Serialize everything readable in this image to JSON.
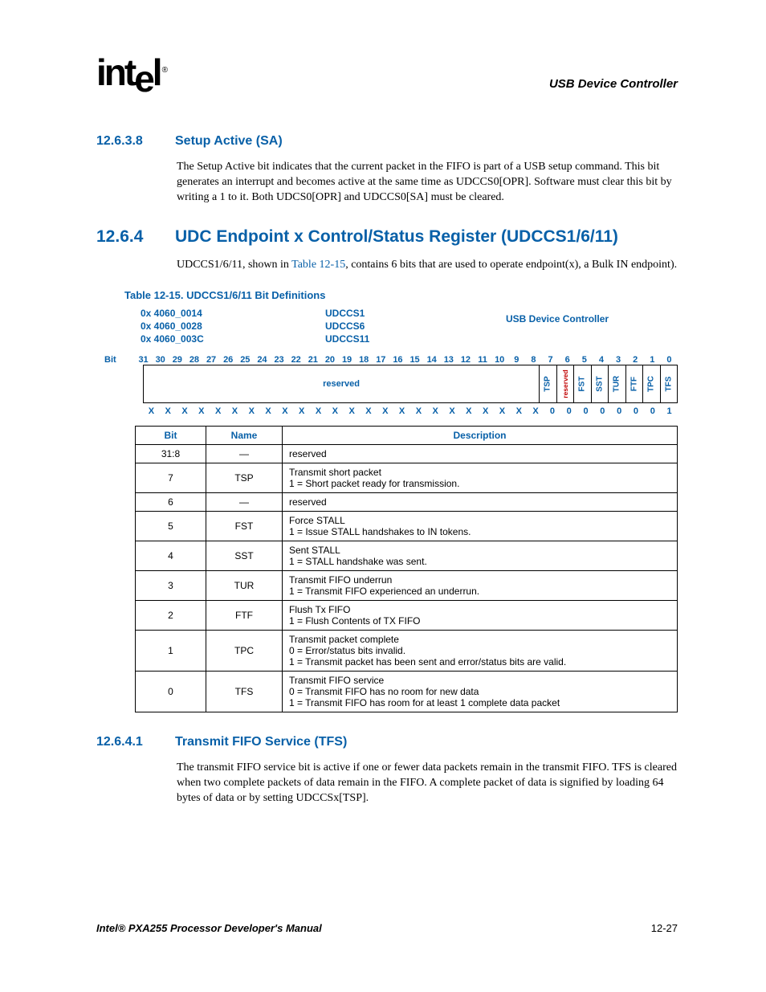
{
  "header": {
    "logo_text": "intel",
    "chapter": "USB Device Controller"
  },
  "sec1": {
    "num": "12.6.3.8",
    "title": "Setup Active (SA)",
    "para": "The Setup Active bit indicates that the current packet in the FIFO is part of a USB setup command. This bit generates an interrupt and becomes active at the same time as UDCCS0[OPR]. Software must clear this bit by writing a 1 to it. Both UDCS0[OPR] and UDCCS0[SA] must be cleared."
  },
  "sec2": {
    "num": "12.6.4",
    "title": "UDc Endpoint x Control/Status Register (UDCCS1/6/11)",
    "title_actual": "UDC Endpoint x Control/Status Register (UDCCS1/6/11)",
    "para_pre": "UDCCS1/6/11, shown in ",
    "para_link": "Table 12-15",
    "para_post": ", contains 6 bits that are used to operate endpoint(x), a Bulk IN endpoint)."
  },
  "table_caption": "Table 12-15. UDCCS1/6/11 Bit Definitions",
  "reg_header": {
    "addrs": [
      "0x 4060_0014",
      "0x 4060_0028",
      "0x 4060_003C"
    ],
    "names": [
      "UDCCS1",
      "UDCCS6",
      "UDCCS11"
    ],
    "module": "USB Device Controller"
  },
  "bits_label": "Bit",
  "bit_numbers": [
    "31",
    "30",
    "29",
    "28",
    "27",
    "26",
    "25",
    "24",
    "23",
    "22",
    "21",
    "20",
    "19",
    "18",
    "17",
    "16",
    "15",
    "14",
    "13",
    "12",
    "11",
    "10",
    "9",
    "8",
    "7",
    "6",
    "5",
    "4",
    "3",
    "2",
    "1",
    "0"
  ],
  "fields": {
    "reserved": "reserved",
    "list": [
      "TSP",
      "reserved",
      "FST",
      "SST",
      "TUR",
      "FTF",
      "TPC",
      "TFS"
    ]
  },
  "reset_values": [
    "X",
    "X",
    "X",
    "X",
    "X",
    "X",
    "X",
    "X",
    "X",
    "X",
    "X",
    "X",
    "X",
    "X",
    "X",
    "X",
    "X",
    "X",
    "X",
    "X",
    "X",
    "X",
    "X",
    "X",
    "0",
    "0",
    "0",
    "0",
    "0",
    "0",
    "0",
    "1"
  ],
  "def_table": {
    "headers": [
      "Bit",
      "Name",
      "Description"
    ],
    "rows": [
      {
        "bit": "31:8",
        "name": "—",
        "desc": "reserved"
      },
      {
        "bit": "7",
        "name": "TSP",
        "desc": "Transmit short packet\n1 =   Short packet ready for transmission."
      },
      {
        "bit": "6",
        "name": "—",
        "desc": "reserved"
      },
      {
        "bit": "5",
        "name": "FST",
        "desc": "Force STALL\n1 =   Issue STALL handshakes to IN tokens."
      },
      {
        "bit": "4",
        "name": "SST",
        "desc": "Sent STALL\n1 =   STALL handshake was sent."
      },
      {
        "bit": "3",
        "name": "TUR",
        "desc": "Transmit FIFO underrun\n1 =   Transmit FIFO experienced an underrun."
      },
      {
        "bit": "2",
        "name": "FTF",
        "desc": "Flush Tx FIFO\n1 =   Flush Contents of TX FIFO"
      },
      {
        "bit": "1",
        "name": "TPC",
        "desc": "Transmit packet complete\n0 =   Error/status bits invalid.\n1 =   Transmit packet has been sent and error/status bits are valid."
      },
      {
        "bit": "0",
        "name": "TFS",
        "desc": "Transmit FIFO service\n0 =   Transmit FIFO has no room for new data\n1 =   Transmit FIFO has room for at least 1 complete data packet"
      }
    ]
  },
  "sec3": {
    "num": "12.6.4.1",
    "title": "Transmit FIFO Service (TFS)",
    "para": "The transmit FIFO service bit is active if one or fewer data packets remain in the transmit FIFO. TFS is cleared when two complete packets of data remain in the FIFO. A complete packet of data is signified by loading 64 bytes of data or by setting UDCCSx[TSP]."
  },
  "footer": {
    "left": "Intel® PXA255 Processor Developer's Manual",
    "right": "12-27"
  }
}
